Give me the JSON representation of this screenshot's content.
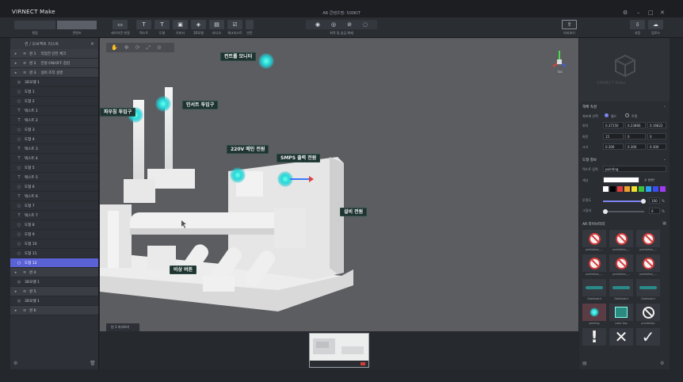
{
  "app": {
    "brand": "VIRNECT Make",
    "title": "AR 콘텐츠명: 500KIT"
  },
  "window_controls": {
    "menu": "⚙",
    "minimize": "–",
    "maximize": "□",
    "close": "✕"
  },
  "toolbar": {
    "mode_tabs": [
      {
        "label": "편집"
      },
      {
        "label": "콘텐츠"
      }
    ],
    "center_tools": [
      {
        "label": "텍스트",
        "icon": "T"
      },
      {
        "label": "도형",
        "icon": "T"
      },
      {
        "label": "이미지",
        "icon": "▣"
      },
      {
        "label": "3D모델",
        "icon": "◈"
      },
      {
        "label": "비디오",
        "icon": "▤"
      },
      {
        "label": "체크리스트",
        "icon": "☑"
      },
      {
        "label": "빈칸",
        "icon": ""
      }
    ],
    "first_tool": {
      "label": "레이아웃 변경",
      "icon": "▭"
    },
    "view_group_label": "최적 및 숨김 해제",
    "right_tool": {
      "label": "미리보기",
      "icon": "⇪"
    },
    "save": {
      "label": "저장",
      "icon": "⇩"
    },
    "upload": {
      "label": "업로드",
      "icon": "☁"
    }
  },
  "left_panel": {
    "title": "씬 / 오브젝트 리스트",
    "rows": [
      {
        "kind": "group",
        "label": "씬 1",
        "text": "작업전 안전 체크"
      },
      {
        "kind": "group",
        "label": "씬 2",
        "text": "전원 ON/OFF 점검"
      },
      {
        "kind": "group",
        "label": "씬 3",
        "text": "설비 조작 설명"
      },
      {
        "kind": "item",
        "icon": "◎",
        "text": "3D모델 1"
      },
      {
        "kind": "item",
        "icon": "○",
        "text": "도형 1"
      },
      {
        "kind": "item",
        "icon": "○",
        "text": "도형 2"
      },
      {
        "kind": "item",
        "icon": "T",
        "text": "텍스트 1"
      },
      {
        "kind": "item",
        "icon": "T",
        "text": "텍스트 2"
      },
      {
        "kind": "item",
        "icon": "○",
        "text": "도형 3"
      },
      {
        "kind": "item",
        "icon": "○",
        "text": "도형 4"
      },
      {
        "kind": "item",
        "icon": "T",
        "text": "텍스트 3"
      },
      {
        "kind": "item",
        "icon": "T",
        "text": "텍스트 4"
      },
      {
        "kind": "item",
        "icon": "○",
        "text": "도형 5"
      },
      {
        "kind": "item",
        "icon": "T",
        "text": "텍스트 5"
      },
      {
        "kind": "item",
        "icon": "○",
        "text": "도형 6"
      },
      {
        "kind": "item",
        "icon": "T",
        "text": "텍스트 6"
      },
      {
        "kind": "item",
        "icon": "○",
        "text": "도형 7"
      },
      {
        "kind": "item",
        "icon": "T",
        "text": "텍스트 7"
      },
      {
        "kind": "item",
        "icon": "○",
        "text": "도형 8"
      },
      {
        "kind": "item",
        "icon": "○",
        "text": "도형 9"
      },
      {
        "kind": "item",
        "icon": "○",
        "text": "도형 10"
      },
      {
        "kind": "item",
        "icon": "○",
        "text": "도형 11"
      },
      {
        "kind": "item",
        "icon": "○",
        "text": "도형 12",
        "selected": true
      },
      {
        "kind": "group",
        "label": "씬 4",
        "text": ""
      },
      {
        "kind": "item",
        "icon": "◎",
        "text": "3D모델 1"
      },
      {
        "kind": "group",
        "label": "씬 5",
        "text": ""
      },
      {
        "kind": "item",
        "icon": "◎",
        "text": "3D모델 1"
      },
      {
        "kind": "group",
        "label": "씬 6",
        "text": ""
      }
    ],
    "footer_left": "⚙",
    "footer_right": "🗑"
  },
  "viewport": {
    "tools": [
      "✋",
      "✥",
      "⟳",
      "⤢",
      "⊘"
    ],
    "axis_label": "Iso",
    "labels": [
      {
        "text": "컨트롤 모니터"
      },
      {
        "text": "인서트 투입구"
      },
      {
        "text": "파우칭 투입구"
      },
      {
        "text": "220V 메인 전원"
      },
      {
        "text": "SMPS 출력 전원"
      },
      {
        "text": "설비 전원"
      },
      {
        "text": "비상 버튼"
      }
    ],
    "tab_label": "씬 1 미리보기"
  },
  "right_panel": {
    "watermark": "VIRNECT Make",
    "transform": {
      "title": "객체 속성",
      "coord_label": "좌표계 선택",
      "radio_world": "월드",
      "radio_local": "로컬",
      "rows": [
        {
          "label": "위치",
          "values": [
            "0.37150",
            "0.23866",
            "0.16822"
          ]
        },
        {
          "label": "회전",
          "values": [
            "15",
            "0",
            "0"
          ]
        },
        {
          "label": "크기",
          "values": [
            "0.300",
            "0.300",
            "0.300"
          ]
        }
      ]
    },
    "shape": {
      "title": "도형 정보",
      "text_label": "텍스트 입력",
      "text_value": "pointing",
      "color_label": "색상",
      "color_hex": "# ffffff",
      "palette": [
        "#ffffff",
        "#000000",
        "#e23c3c",
        "#f0a02c",
        "#f0e02c",
        "#3cc23c",
        "#2ca0f0",
        "#3c4cf0",
        "#a03cf0"
      ],
      "opacity_label": "투명도",
      "opacity_value": "100",
      "opacity_unit": "%",
      "shadow_label": "그림자",
      "shadow_value": "0",
      "shadow_unit": "%"
    },
    "library": {
      "title": "AR 라이브러리",
      "items": [
        {
          "label": "prohibition_...",
          "kind": "prohib"
        },
        {
          "label": "prohibition_...",
          "kind": "prohib"
        },
        {
          "label": "prohibition_...",
          "kind": "prohib"
        },
        {
          "label": "prohibition_...",
          "kind": "prohib"
        },
        {
          "label": "prohibition_...",
          "kind": "prohib"
        },
        {
          "label": "prohibition_...",
          "kind": "prohib"
        },
        {
          "label": "Dashboard",
          "kind": "dash"
        },
        {
          "label": "Dashboard",
          "kind": "dash"
        },
        {
          "label": "Dashboard",
          "kind": "dash"
        },
        {
          "label": "pointing",
          "kind": "pointing"
        },
        {
          "label": "point box",
          "kind": "pointbox"
        },
        {
          "label": "prohibition",
          "kind": "slash"
        },
        {
          "label": "",
          "kind": "exclaim"
        },
        {
          "label": "",
          "kind": "cross"
        },
        {
          "label": "",
          "kind": "check"
        }
      ]
    }
  }
}
